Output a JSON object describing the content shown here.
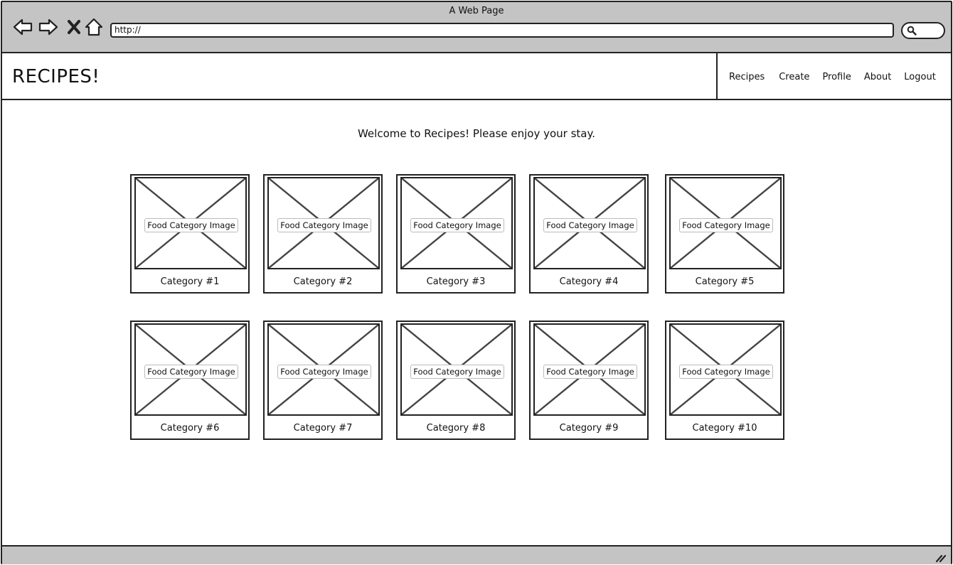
{
  "window": {
    "title": "A Web Page"
  },
  "browser": {
    "url": "http://",
    "icons": [
      "back-arrow-icon",
      "forward-arrow-icon",
      "close-x-icon",
      "home-icon",
      "search-icon",
      "resize-grip-icon"
    ]
  },
  "header": {
    "logo": "RECIPES!",
    "nav": [
      "Recipes",
      "Create",
      "Profile",
      "About",
      "Logout"
    ]
  },
  "main": {
    "welcome": "Welcome to Recipes! Please enjoy your stay.",
    "image_placeholder_label": "Food Category Image",
    "categories": [
      "Category #1",
      "Category #2",
      "Category #3",
      "Category #4",
      "Category #5",
      "Category #6",
      "Category #7",
      "Category #8",
      "Category #9",
      "Category #10"
    ]
  },
  "colors": {
    "chrome": "#c4c4c4",
    "stroke": "#222222",
    "background": "#ffffff"
  }
}
